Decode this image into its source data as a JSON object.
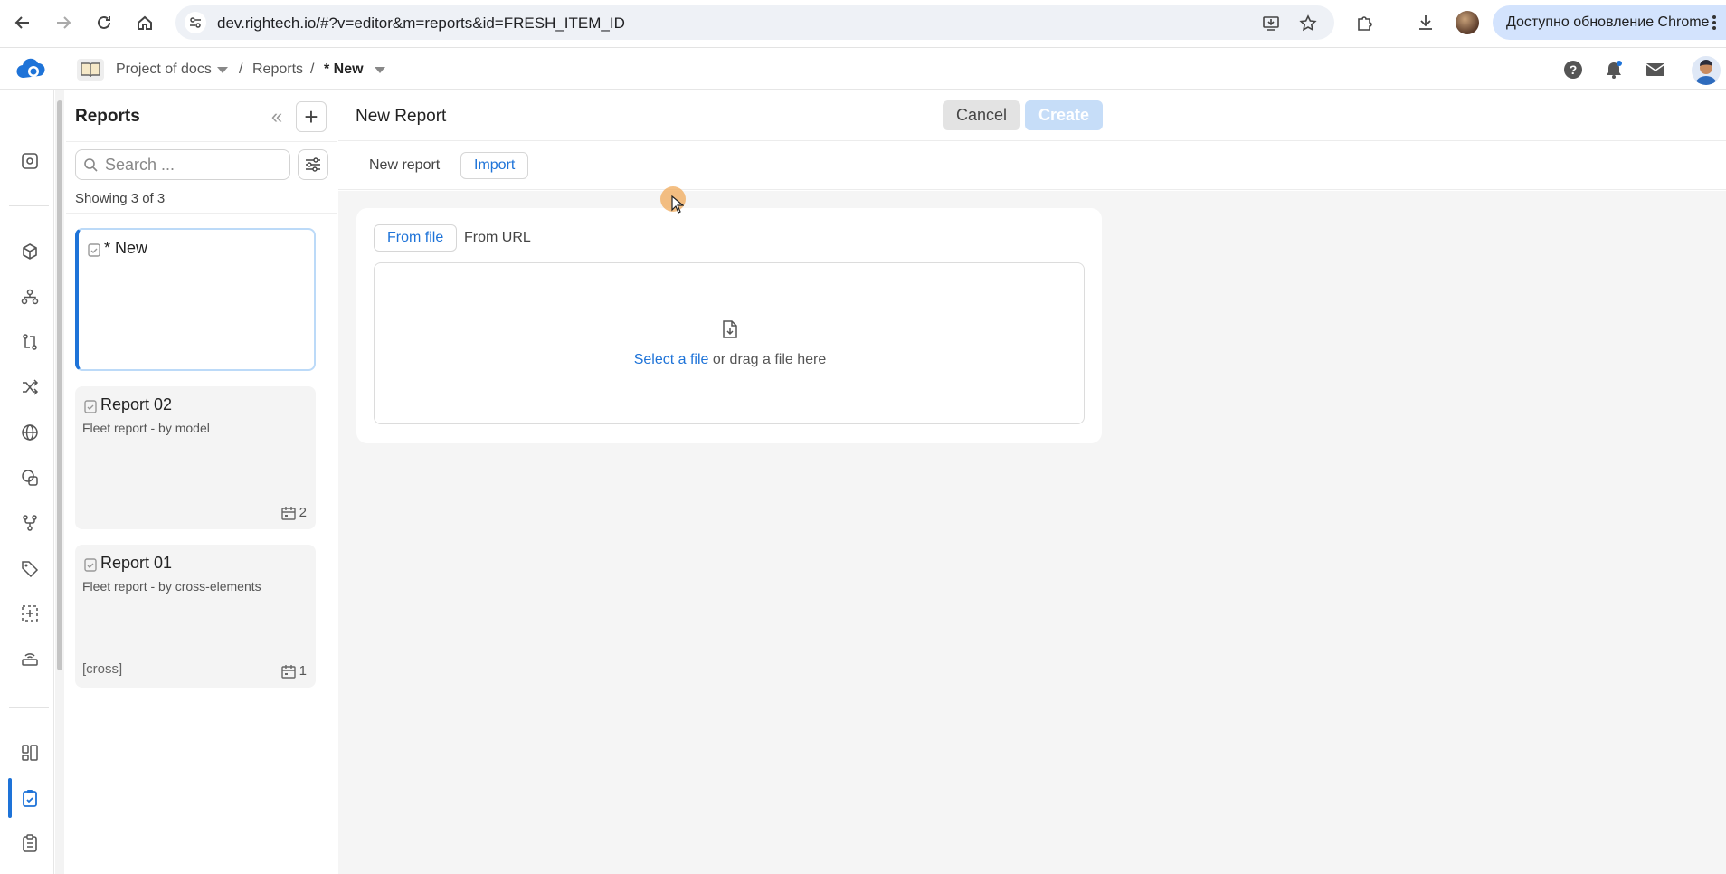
{
  "browser": {
    "url": "dev.rightech.io/#?v=editor&m=reports&id=FRESH_ITEM_ID",
    "update_label": "Доступно обновление Chrome"
  },
  "header": {
    "breadcrumb": {
      "project": "Project of docs",
      "sep1": "/",
      "section": "Reports",
      "sep2": "/",
      "current": "* New"
    }
  },
  "sidebar": {
    "title": "Reports",
    "search_placeholder": "Search ...",
    "showing": "Showing 3 of 3",
    "items": [
      {
        "title": "* New",
        "subtitle": "",
        "tag": "",
        "count": ""
      },
      {
        "title": "Report 02",
        "subtitle": "Fleet report - by model",
        "tag": "",
        "count": "2"
      },
      {
        "title": "Report 01",
        "subtitle": "Fleet report - by cross-elements",
        "tag": "[cross]",
        "count": "1"
      }
    ]
  },
  "main": {
    "title": "New Report",
    "cancel_label": "Cancel",
    "create_label": "Create",
    "tabs": [
      "New report",
      "Import"
    ],
    "active_tab": "Import",
    "import": {
      "tabs": [
        "From file",
        "From URL"
      ],
      "active_tab": "From file",
      "select_link": "Select a file",
      "drop_text": " or drag a file here"
    }
  },
  "colors": {
    "accent": "#1e73d8",
    "create_disabled": "#c6ddf8",
    "update_pill": "#d3e3fd"
  }
}
